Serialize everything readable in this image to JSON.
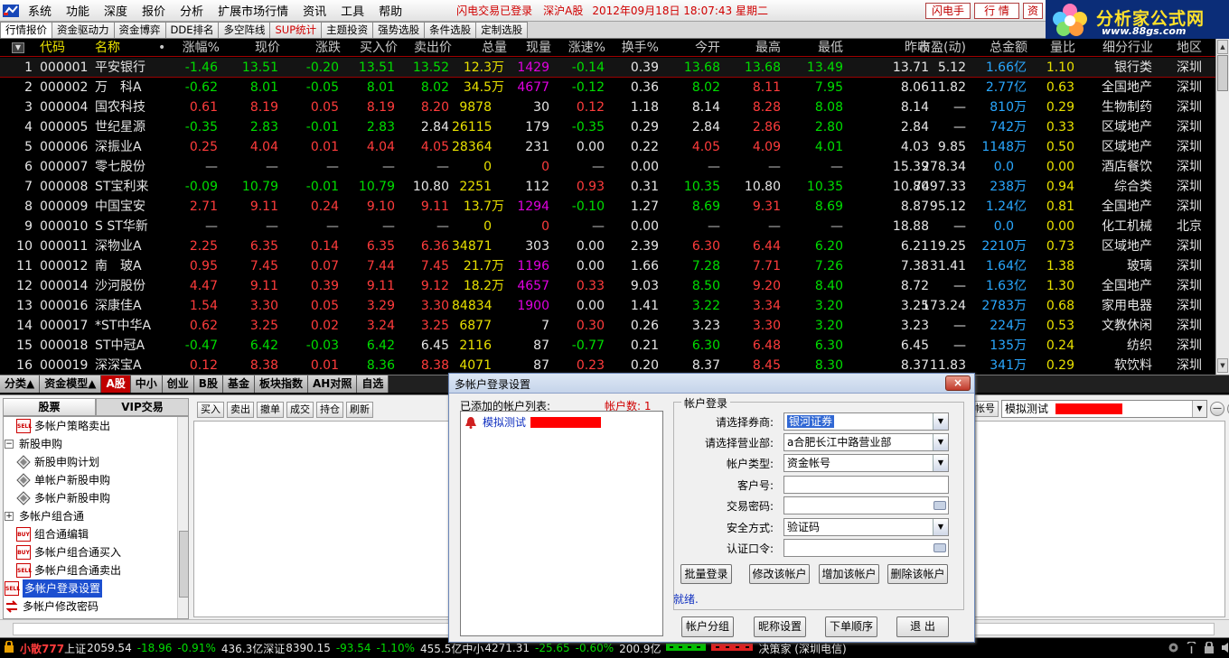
{
  "menubar": {
    "logo_icon": "app-logo-icon",
    "items": [
      "系统",
      "功能",
      "深度",
      "报价",
      "分析",
      "扩展市场行情",
      "资讯",
      "工具",
      "帮助"
    ],
    "login_status": "闪电交易已登录",
    "market": "深沪A股",
    "datetime": "2012年09月18日  18:07:43 星期二",
    "buttons": [
      "闪电手",
      "行 情",
      "资"
    ]
  },
  "brand": {
    "name": "分析家公式网",
    "url": "www.88gs.com",
    "icon": "flower-logo-icon"
  },
  "top_tabs": [
    "行情报价",
    "资金驱动力",
    "资金博弈",
    "DDE排名",
    "多空阵线",
    "SUP统计",
    "主题投资",
    "强势选股",
    "条件选股",
    "定制选股"
  ],
  "active_top_tab": 0,
  "red_top_tab": 5,
  "grid": {
    "columns": [
      "代码",
      "名称",
      "•",
      "涨幅%",
      "现价",
      "涨跌",
      "买入价",
      "卖出价",
      "总量",
      "现量",
      "涨速%",
      "换手%",
      "今开",
      "最高",
      "最低",
      "昨收",
      "市盈(动)",
      "总金额",
      "量比",
      "细分行业",
      "地区"
    ],
    "rows": [
      {
        "n": "1",
        "code": "000001",
        "name": "平安银行",
        "chg": "-1.46",
        "price": "13.51",
        "diff": "-0.20",
        "bid": "13.51",
        "ask": "13.52",
        "vol": "12.3",
        "vol_u": "万",
        "cur": "1429",
        "spd": "-0.14",
        "turn": "0.39",
        "open": "13.68",
        "high": "13.68",
        "low": "13.49",
        "prev": "13.71",
        "pe": "5.12",
        "amt": "1.66",
        "amt_u": "亿",
        "qr": "1.10",
        "ind": "银行类",
        "reg": "深圳"
      },
      {
        "n": "2",
        "code": "000002",
        "name": "万　科A",
        "chg": "-0.62",
        "price": "8.01",
        "diff": "-0.05",
        "bid": "8.01",
        "ask": "8.02",
        "vol": "34.5",
        "vol_u": "万",
        "cur": "4677",
        "spd": "-0.12",
        "turn": "0.36",
        "open": "8.02",
        "high": "8.11",
        "low": "7.95",
        "prev": "8.06",
        "pe": "11.82",
        "amt": "2.77",
        "amt_u": "亿",
        "qr": "0.63",
        "ind": "全国地产",
        "reg": "深圳"
      },
      {
        "n": "3",
        "code": "000004",
        "name": "国农科技",
        "chg": "0.61",
        "price": "8.19",
        "diff": "0.05",
        "bid": "8.19",
        "ask": "8.20",
        "vol": "9878",
        "vol_u": "",
        "cur": "30",
        "spd": "0.12",
        "turn": "1.18",
        "open": "8.14",
        "high": "8.28",
        "low": "8.08",
        "prev": "8.14",
        "pe": "—",
        "amt": "810",
        "amt_u": "万",
        "qr": "0.29",
        "ind": "生物制药",
        "reg": "深圳"
      },
      {
        "n": "4",
        "code": "000005",
        "name": "世纪星源",
        "chg": "-0.35",
        "price": "2.83",
        "diff": "-0.01",
        "bid": "2.83",
        "ask": "2.84",
        "vol": "26115",
        "vol_u": "",
        "cur": "179",
        "spd": "-0.35",
        "turn": "0.29",
        "open": "2.84",
        "high": "2.86",
        "low": "2.80",
        "prev": "2.84",
        "pe": "—",
        "amt": "742",
        "amt_u": "万",
        "qr": "0.33",
        "ind": "区域地产",
        "reg": "深圳"
      },
      {
        "n": "5",
        "code": "000006",
        "name": "深振业A",
        "chg": "0.25",
        "price": "4.04",
        "diff": "0.01",
        "bid": "4.04",
        "ask": "4.05",
        "vol": "28364",
        "vol_u": "",
        "cur": "231",
        "spd": "0.00",
        "turn": "0.22",
        "open": "4.05",
        "high": "4.09",
        "low": "4.01",
        "prev": "4.03",
        "pe": "9.85",
        "amt": "1148",
        "amt_u": "万",
        "qr": "0.50",
        "ind": "区域地产",
        "reg": "深圳"
      },
      {
        "n": "6",
        "code": "000007",
        "name": "零七股份",
        "chg": "—",
        "price": "—",
        "diff": "—",
        "bid": "—",
        "ask": "—",
        "vol": "0",
        "vol_u": "",
        "cur": "0",
        "spd": "—",
        "turn": "0.00",
        "open": "—",
        "high": "—",
        "low": "—",
        "prev": "15.39",
        "pe": "278.34",
        "amt": "0.0",
        "amt_u": "",
        "qr": "0.00",
        "ind": "酒店餐饮",
        "reg": "深圳"
      },
      {
        "n": "7",
        "code": "000008",
        "name": "ST宝利来",
        "chg": "-0.09",
        "price": "10.79",
        "diff": "-0.01",
        "bid": "10.79",
        "ask": "10.80",
        "vol": "2251",
        "vol_u": "",
        "cur": "112",
        "spd": "0.93",
        "turn": "0.31",
        "open": "10.35",
        "high": "10.80",
        "low": "10.35",
        "prev": "10.80",
        "pe": "7497.33",
        "amt": "238",
        "amt_u": "万",
        "qr": "0.94",
        "ind": "综合类",
        "reg": "深圳"
      },
      {
        "n": "8",
        "code": "000009",
        "name": "中国宝安",
        "chg": "2.71",
        "price": "9.11",
        "diff": "0.24",
        "bid": "9.10",
        "ask": "9.11",
        "vol": "13.7",
        "vol_u": "万",
        "cur": "1294",
        "spd": "-0.10",
        "turn": "1.27",
        "open": "8.69",
        "high": "9.31",
        "low": "8.69",
        "prev": "8.87",
        "pe": "95.12",
        "amt": "1.24",
        "amt_u": "亿",
        "qr": "0.81",
        "ind": "全国地产",
        "reg": "深圳"
      },
      {
        "n": "9",
        "code": "000010",
        "name": "S ST华新",
        "chg": "—",
        "price": "—",
        "diff": "—",
        "bid": "—",
        "ask": "—",
        "vol": "0",
        "vol_u": "",
        "cur": "0",
        "spd": "—",
        "turn": "0.00",
        "open": "—",
        "high": "—",
        "low": "—",
        "prev": "18.88",
        "pe": "—",
        "amt": "0.0",
        "amt_u": "",
        "qr": "0.00",
        "ind": "化工机械",
        "reg": "北京"
      },
      {
        "n": "10",
        "code": "000011",
        "name": "深物业A",
        "chg": "2.25",
        "price": "6.35",
        "diff": "0.14",
        "bid": "6.35",
        "ask": "6.36",
        "vol": "34871",
        "vol_u": "",
        "cur": "303",
        "spd": "0.00",
        "turn": "2.39",
        "open": "6.30",
        "high": "6.44",
        "low": "6.20",
        "prev": "6.21",
        "pe": "19.25",
        "amt": "2210",
        "amt_u": "万",
        "qr": "0.73",
        "ind": "区域地产",
        "reg": "深圳"
      },
      {
        "n": "11",
        "code": "000012",
        "name": "南　玻A",
        "chg": "0.95",
        "price": "7.45",
        "diff": "0.07",
        "bid": "7.44",
        "ask": "7.45",
        "vol": "21.7",
        "vol_u": "万",
        "cur": "1196",
        "spd": "0.00",
        "turn": "1.66",
        "open": "7.28",
        "high": "7.71",
        "low": "7.26",
        "prev": "7.38",
        "pe": "31.41",
        "amt": "1.64",
        "amt_u": "亿",
        "qr": "1.38",
        "ind": "玻璃",
        "reg": "深圳"
      },
      {
        "n": "12",
        "code": "000014",
        "name": "沙河股份",
        "chg": "4.47",
        "price": "9.11",
        "diff": "0.39",
        "bid": "9.11",
        "ask": "9.12",
        "vol": "18.2",
        "vol_u": "万",
        "cur": "4657",
        "spd": "0.33",
        "turn": "9.03",
        "open": "8.50",
        "high": "9.20",
        "low": "8.40",
        "prev": "8.72",
        "pe": "—",
        "amt": "1.63",
        "amt_u": "亿",
        "qr": "1.30",
        "ind": "全国地产",
        "reg": "深圳"
      },
      {
        "n": "13",
        "code": "000016",
        "name": "深康佳A",
        "chg": "1.54",
        "price": "3.30",
        "diff": "0.05",
        "bid": "3.29",
        "ask": "3.30",
        "vol": "84834",
        "vol_u": "",
        "cur": "1900",
        "spd": "0.00",
        "turn": "1.41",
        "open": "3.22",
        "high": "3.34",
        "low": "3.20",
        "prev": "3.25",
        "pe": "173.24",
        "amt": "2783",
        "amt_u": "万",
        "qr": "0.68",
        "ind": "家用电器",
        "reg": "深圳"
      },
      {
        "n": "14",
        "code": "000017",
        "name": "*ST中华A",
        "chg": "0.62",
        "price": "3.25",
        "diff": "0.02",
        "bid": "3.24",
        "ask": "3.25",
        "vol": "6877",
        "vol_u": "",
        "cur": "7",
        "spd": "0.30",
        "turn": "0.26",
        "open": "3.23",
        "high": "3.30",
        "low": "3.20",
        "prev": "3.23",
        "pe": "—",
        "amt": "224",
        "amt_u": "万",
        "qr": "0.53",
        "ind": "文教休闲",
        "reg": "深圳"
      },
      {
        "n": "15",
        "code": "000018",
        "name": "ST中冠A",
        "chg": "-0.47",
        "price": "6.42",
        "diff": "-0.03",
        "bid": "6.42",
        "ask": "6.45",
        "vol": "2116",
        "vol_u": "",
        "cur": "87",
        "spd": "-0.77",
        "turn": "0.21",
        "open": "6.30",
        "high": "6.48",
        "low": "6.30",
        "prev": "6.45",
        "pe": "—",
        "amt": "135",
        "amt_u": "万",
        "qr": "0.24",
        "ind": "纺织",
        "reg": "深圳"
      },
      {
        "n": "16",
        "code": "000019",
        "name": "深深宝A",
        "chg": "0.12",
        "price": "8.38",
        "diff": "0.01",
        "bid": "8.36",
        "ask": "8.38",
        "vol": "4071",
        "vol_u": "",
        "cur": "87",
        "spd": "0.23",
        "turn": "0.20",
        "open": "8.37",
        "high": "8.45",
        "low": "8.30",
        "prev": "8.37",
        "pe": "11.83",
        "amt": "341",
        "amt_u": "万",
        "qr": "0.29",
        "ind": "软饮料",
        "reg": "深圳"
      }
    ]
  },
  "bottom_tabs": [
    "分类▲",
    "资金模型▲",
    "A股",
    "中小",
    "创业",
    "B股",
    "基金",
    "板块指数",
    "AH对照",
    "自选"
  ],
  "active_bottom_tab": 2,
  "trade": {
    "left_tabs": [
      "股票",
      "VIP交易"
    ],
    "active_left_tab": 1,
    "tree": [
      {
        "label": "多帐户策略卖出",
        "icon": "sell"
      },
      {
        "label": "新股申购",
        "icon": "minus"
      },
      {
        "label": "新股申购计划",
        "icon": "diamond"
      },
      {
        "label": "单帐户新股申购",
        "icon": "diamond"
      },
      {
        "label": "多帐户新股申购",
        "icon": "diamond"
      },
      {
        "label": "多帐户组合通",
        "icon": "plus"
      },
      {
        "label": "组合通编辑",
        "icon": "buy"
      },
      {
        "label": "多帐户组合通买入",
        "icon": "buy"
      },
      {
        "label": "多帐户组合通卖出",
        "icon": "sell"
      },
      {
        "label": "多帐户登录设置",
        "icon": "sell"
      },
      {
        "label": "多帐户修改密码",
        "icon": "arrows"
      }
    ],
    "tree_icon_text": {
      "sell": "SELL",
      "buy": "BUY"
    },
    "toolbar": [
      "买入",
      "卖出",
      "撤单",
      "成交",
      "持仓",
      "刷新"
    ],
    "account_label": "帐号",
    "account_value": "模拟测试",
    "window_buttons": [
      "—",
      "□",
      "×"
    ]
  },
  "statusbar": {
    "ticker_name": "小散777",
    "sh_label": "上证",
    "sh": "2059.54",
    "sh_chg": "-18.96",
    "sh_pct": "-0.91%",
    "sh_amt": "436.3亿",
    "sz_label": "深证",
    "sz": "8390.15",
    "sz_chg": "-93.54",
    "sz_pct": "-1.10%",
    "sz_amt": "455.5亿",
    "zx_label": "中小",
    "zx": "4271.31",
    "zx_chg": "-25.65",
    "zx_pct": "-0.60%",
    "zx_amt": "200.9亿",
    "broker": "决策家 (深圳电信)",
    "colors": {
      "up": "#ff3c3c",
      "down": "#00dd00",
      "neutral": "#e6e6e6",
      "accent": "#e8e000"
    }
  },
  "dialog": {
    "title": "多帐户登录设置",
    "close_label": "×",
    "list_label": "已添加的帐户列表:",
    "count_label": "帐户数: 1",
    "accounts": [
      {
        "name": "模拟测试",
        "icon": "bell-icon"
      }
    ],
    "login_group_title": "帐户登录",
    "fields": [
      {
        "label": "请选择券商:",
        "value": "银河证券",
        "type": "select"
      },
      {
        "label": "请选择营业部:",
        "value": "a合肥长江中路营业部",
        "type": "select"
      },
      {
        "label": "帐户类型:",
        "value": "资金帐号",
        "type": "select"
      },
      {
        "label": "客户号:",
        "value": "",
        "type": "input"
      },
      {
        "label": "交易密码:",
        "value": "",
        "type": "password"
      },
      {
        "label": "安全方式:",
        "value": "验证码",
        "type": "select"
      },
      {
        "label": "认证口令:",
        "value": "",
        "type": "password"
      }
    ],
    "actions": [
      "批量登录",
      "修改该帐户",
      "增加该帐户",
      "删除该帐户"
    ],
    "ready": "就绪.",
    "footer_buttons": [
      "帐户分组",
      "昵称设置",
      "下单顺序",
      "退 出"
    ]
  }
}
